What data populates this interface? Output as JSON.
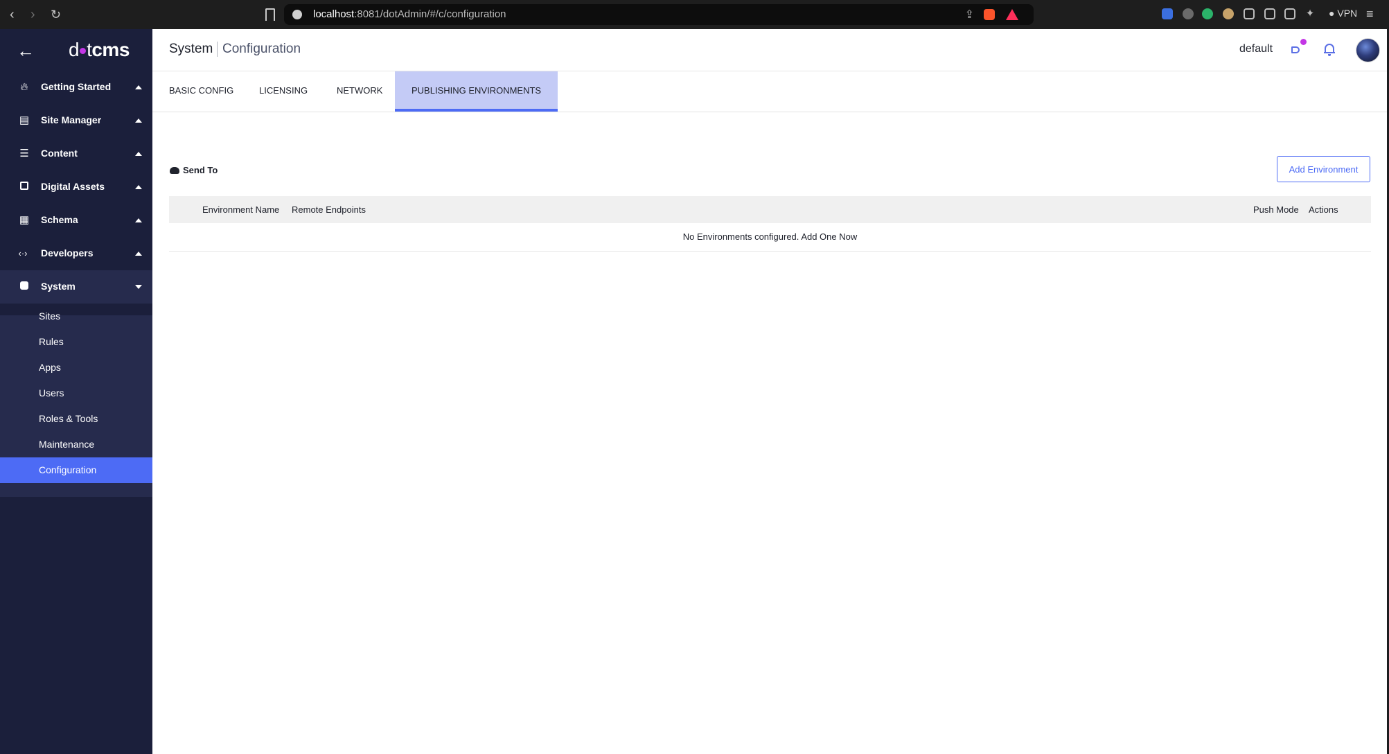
{
  "browser": {
    "url_host": "localhost",
    "url_rest": ":8081/dotAdmin/#/c/configuration",
    "vpn_label": "VPN"
  },
  "sidebar": {
    "logo_text_left": "d",
    "logo_text_mid": "t",
    "logo_text_right": "cms",
    "back_icon": "arrow-left-icon",
    "menu": [
      {
        "label": "Getting Started",
        "icon": "fire-icon",
        "caret": "up"
      },
      {
        "label": "Site Manager",
        "icon": "server-icon",
        "caret": "up"
      },
      {
        "label": "Content",
        "icon": "list-icon",
        "caret": "up"
      },
      {
        "label": "Digital Assets",
        "icon": "folder-icon",
        "caret": "up"
      },
      {
        "label": "Schema",
        "icon": "calendar-icon",
        "caret": "up"
      },
      {
        "label": "Developers",
        "icon": "code-icon",
        "caret": "up"
      },
      {
        "label": "System",
        "icon": "gear-box-icon",
        "caret": "down"
      }
    ],
    "submenu": [
      {
        "label": "Sites"
      },
      {
        "label": "Rules"
      },
      {
        "label": "Apps"
      },
      {
        "label": "Users"
      },
      {
        "label": "Roles & Tools"
      },
      {
        "label": "Maintenance"
      },
      {
        "label": "Configuration",
        "active": true
      }
    ]
  },
  "header": {
    "breadcrumb_main": "System",
    "breadcrumb_sub": "Configuration",
    "site": "default"
  },
  "tabs": [
    {
      "label": "BASIC CONFIG"
    },
    {
      "label": "LICENSING"
    },
    {
      "label": "NETWORK"
    },
    {
      "label": "PUBLISHING ENVIRONMENTS",
      "active": true
    }
  ],
  "content": {
    "section_title": "Send To",
    "add_button": "Add Environment",
    "columns": {
      "name": "Environment Name",
      "endpoints": "Remote Endpoints",
      "push_mode": "Push Mode",
      "actions": "Actions"
    },
    "empty_text": "No Environments configured.",
    "empty_link": "Add One Now"
  },
  "colors": {
    "sidebar_bg": "#1b1f3b",
    "accent": "#4d6bf5",
    "active_tab_bg": "#c4cbf6",
    "badge": "#c336e5"
  }
}
